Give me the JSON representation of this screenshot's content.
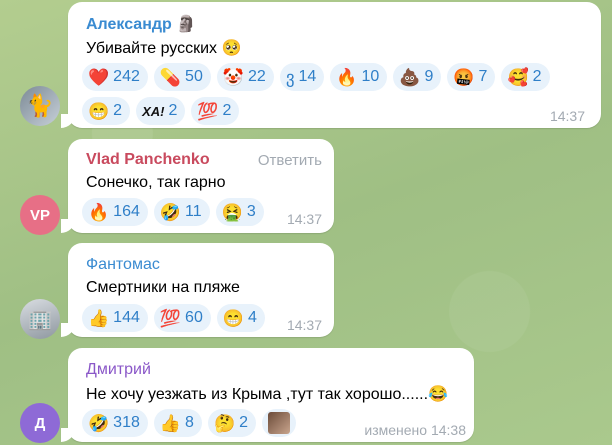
{
  "messages": [
    {
      "author": "Александр",
      "author_badge": "🗿",
      "author_color": "#3a8bd1",
      "text": "Убивайте русских 🥺",
      "time": "14:37",
      "reactions": [
        {
          "emoji": "❤️",
          "count": "242"
        },
        {
          "emoji": "💊",
          "count": "50"
        },
        {
          "emoji": "🤡",
          "count": "22"
        },
        {
          "emoji": "ვ",
          "count": "14"
        },
        {
          "emoji": "🔥",
          "count": "10"
        },
        {
          "emoji": "💩",
          "count": "9"
        },
        {
          "emoji": "🤬",
          "count": "7"
        },
        {
          "emoji": "🥰",
          "count": "2"
        },
        {
          "emoji": "😁",
          "count": "2"
        },
        {
          "emoji": "ХА!",
          "count": "2"
        },
        {
          "emoji": "💯",
          "count": "2"
        }
      ]
    },
    {
      "author": "Vlad Panchenko",
      "author_color": "#c94a5e",
      "reply_label": "Ответить",
      "avatar_initials": "VP",
      "text": "Сонечко, так гарно",
      "time": "14:37",
      "reactions": [
        {
          "emoji": "🔥",
          "count": "164"
        },
        {
          "emoji": "🤣",
          "count": "11"
        },
        {
          "emoji": "🤮",
          "count": "3"
        }
      ]
    },
    {
      "author": "Фантомас",
      "author_color": "#3a8bd1",
      "text": "Смертники на пляже",
      "time": "14:37",
      "reactions": [
        {
          "emoji": "👍",
          "count": "144"
        },
        {
          "emoji": "💯",
          "count": "60"
        },
        {
          "emoji": "😁",
          "count": "4"
        }
      ]
    },
    {
      "author": "Дмитрий",
      "author_color": "#8a57c8",
      "avatar_initials": "Д",
      "text": "Не хочу уезжать из Крыма ,тут так хорошо......😂",
      "time": "изменено 14:38",
      "reactions": [
        {
          "emoji": "🤣",
          "count": "318"
        },
        {
          "emoji": "👍",
          "count": "8"
        },
        {
          "emoji": "🤔",
          "count": "2"
        },
        {
          "emoji": "user-photo",
          "count": ""
        }
      ]
    }
  ]
}
